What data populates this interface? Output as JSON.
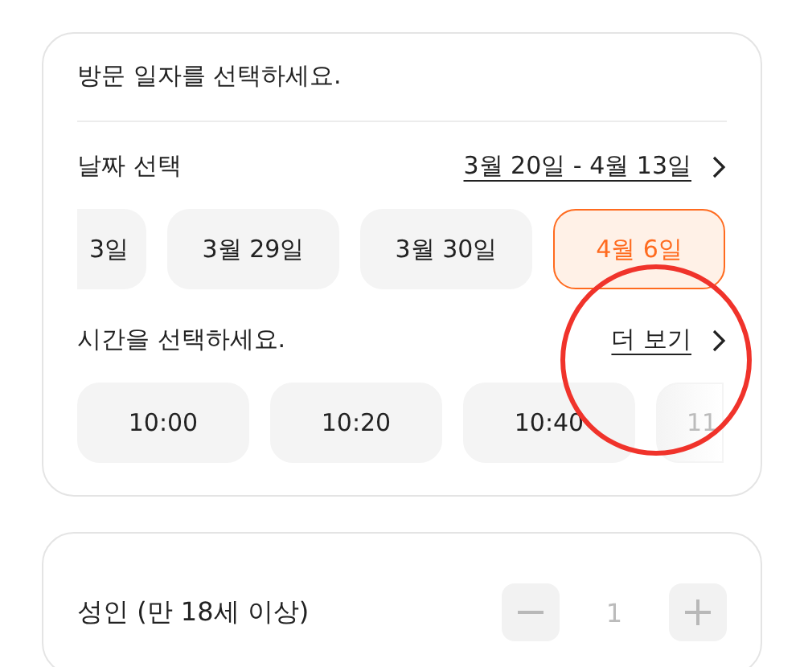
{
  "date_card": {
    "title": "방문 일자를 선택하세요.",
    "date_label": "날짜 선택",
    "date_range": "3월 20일 - 4월 13일",
    "dates": [
      {
        "label": "3일",
        "selected": false,
        "kind": "leading"
      },
      {
        "label": "3월 29일",
        "selected": false,
        "kind": "full"
      },
      {
        "label": "3월 30일",
        "selected": false,
        "kind": "full"
      },
      {
        "label": "4월 6일",
        "selected": true,
        "kind": "full"
      }
    ],
    "time_label": "시간을 선택하세요.",
    "more_link": "더 보기",
    "times": [
      {
        "label": "10:00",
        "selected": false,
        "kind": "full"
      },
      {
        "label": "10:20",
        "selected": false,
        "kind": "full"
      },
      {
        "label": "10:40",
        "selected": false,
        "kind": "full"
      },
      {
        "label": "11",
        "selected": false,
        "kind": "trailing"
      }
    ]
  },
  "guest_card": {
    "rows": [
      {
        "label": "성인 (만 18세 이상)",
        "count": "1",
        "disabled": true
      }
    ]
  }
}
